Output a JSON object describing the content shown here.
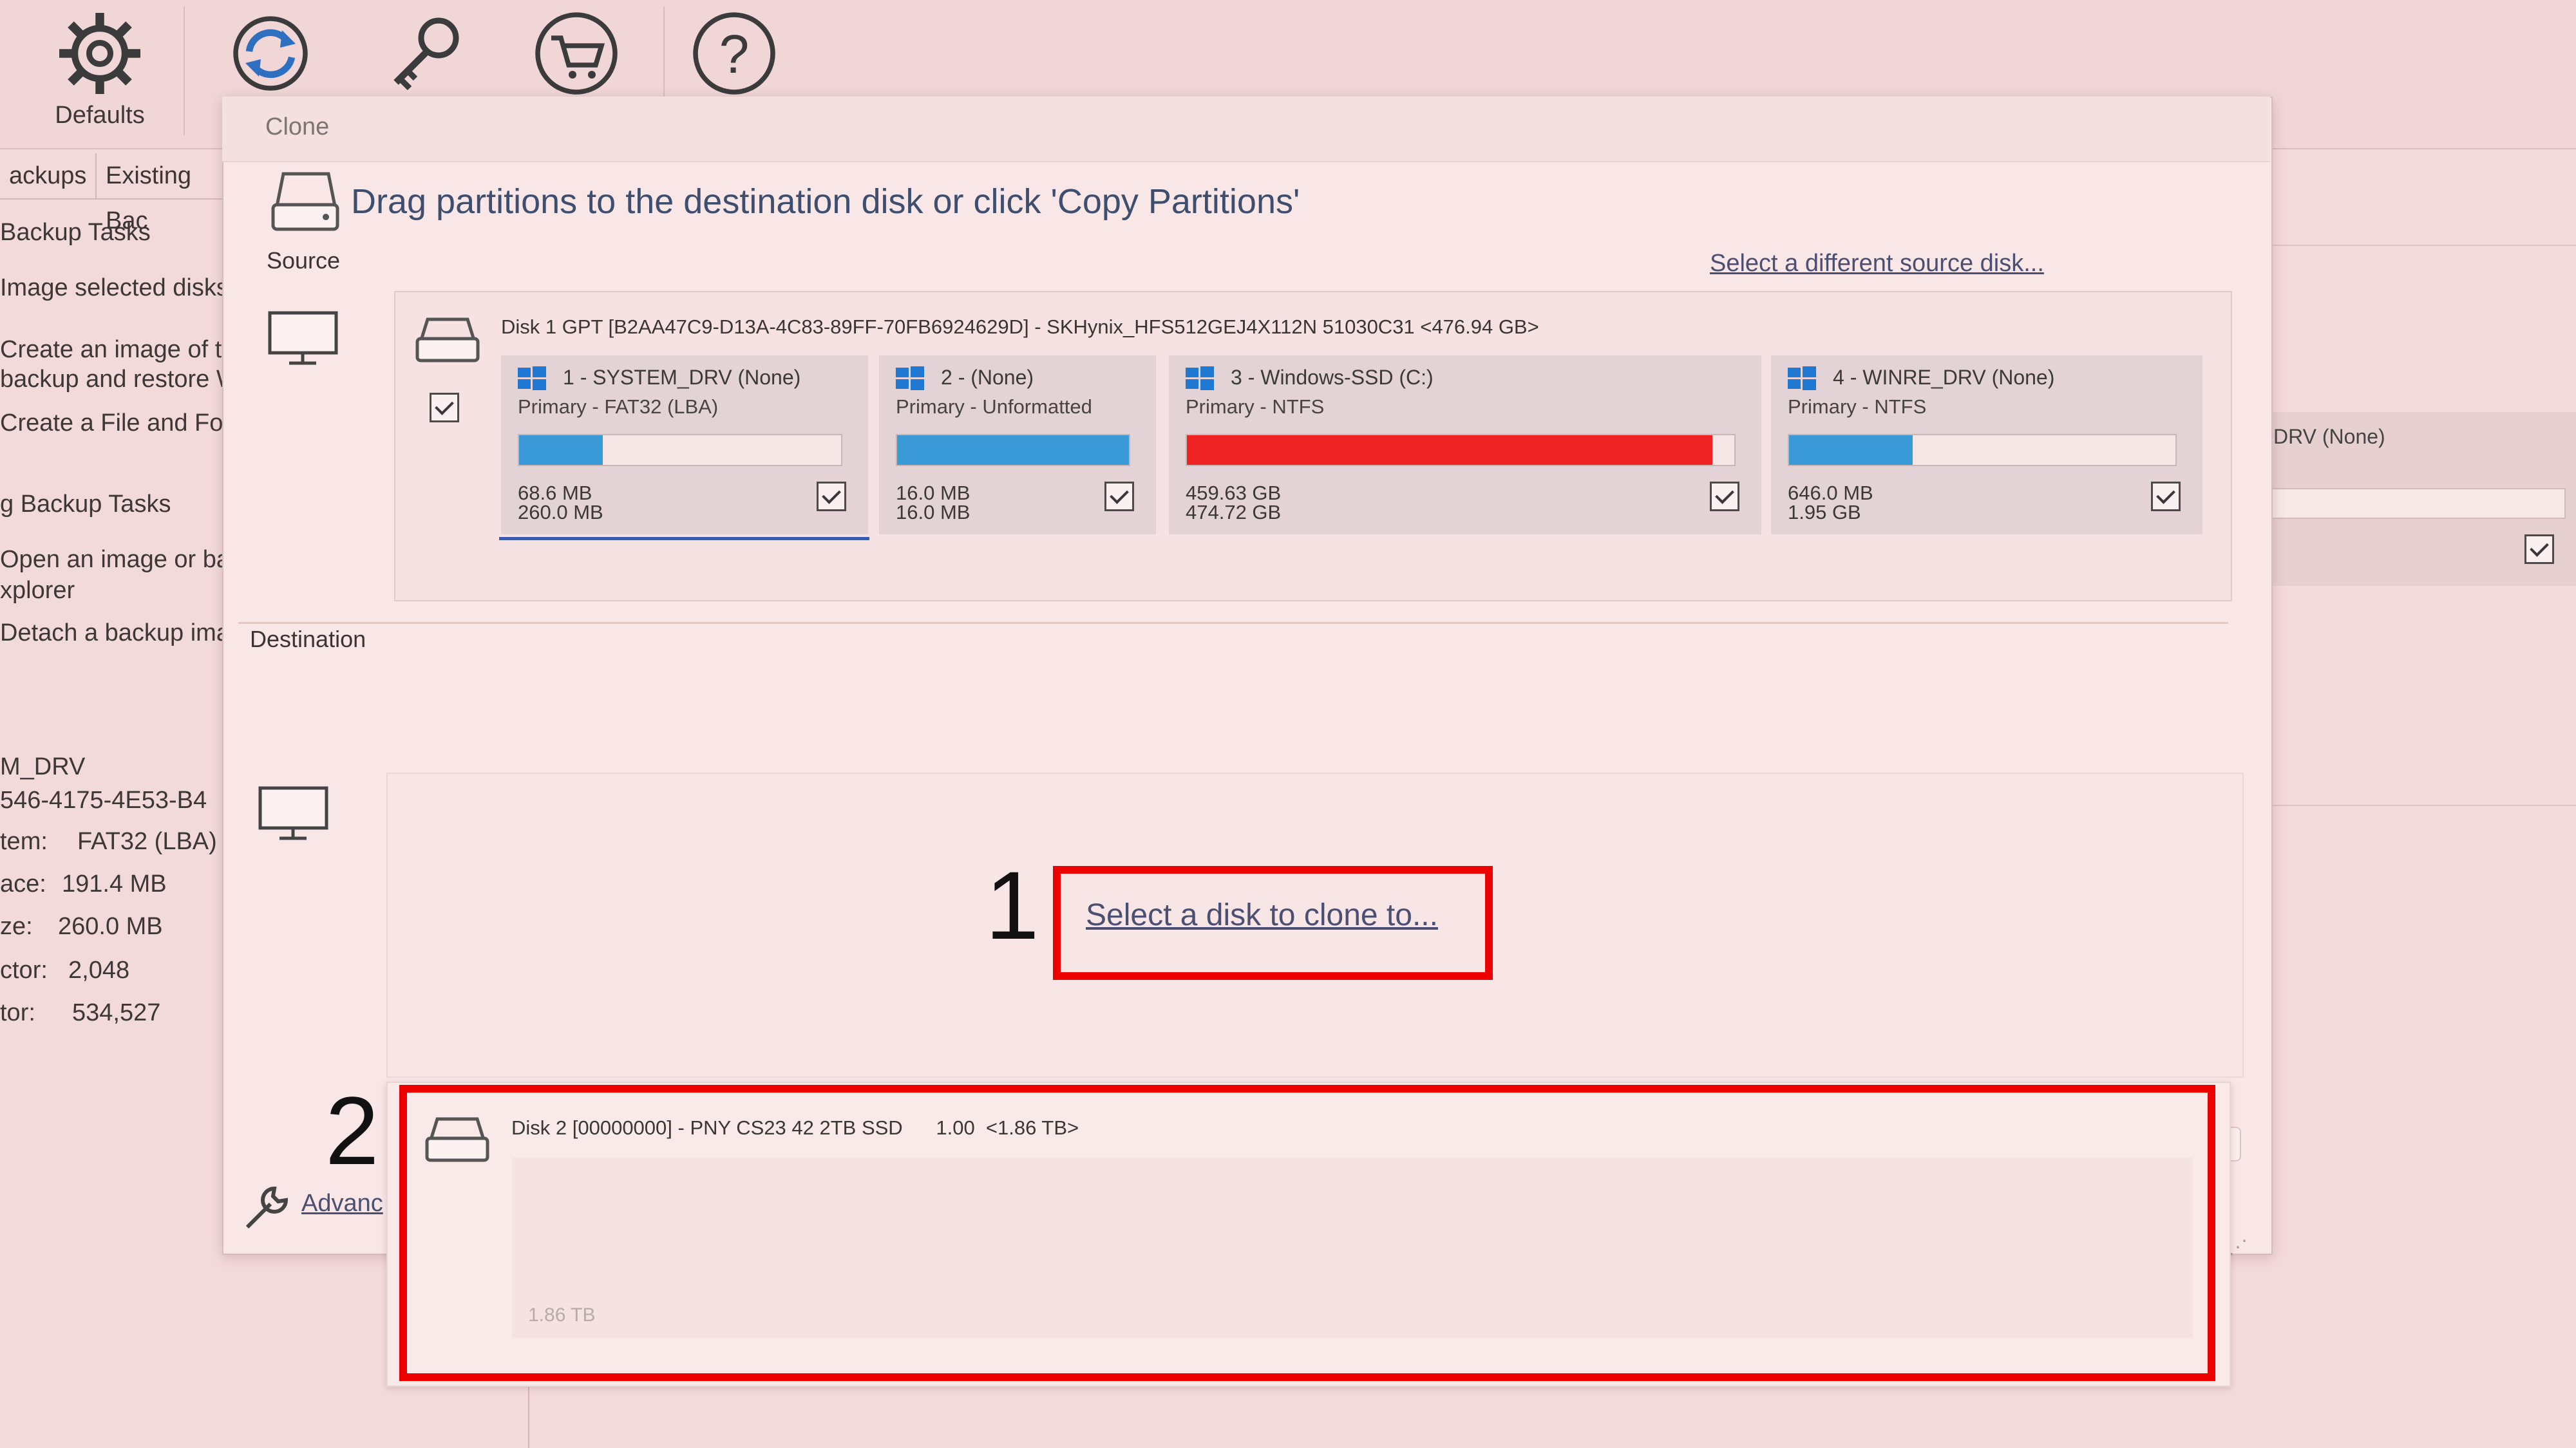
{
  "toolbar": {
    "defaults_label": "Defaults",
    "updates_label": "U"
  },
  "left_panel": {
    "tabs": [
      "ackups",
      "Existing Bac"
    ],
    "lines": [
      "Backup Tasks",
      "Image selected disks",
      "Create an image of th",
      "backup and restore W",
      "Create a File and Fold",
      "g Backup Tasks",
      "Open an image or ba",
      "xplorer",
      "Detach a backup ima"
    ],
    "details": {
      "name": "M_DRV",
      "guid": "546-4175-4E53-B4",
      "fs_label": "tem:",
      "fs_value": "FAT32 (LBA)",
      "free_label": "ace:",
      "free_value": "191.4 MB",
      "size_label": "ze:",
      "size_value": "260.0 MB",
      "first_label": "ctor:",
      "first_value": "2,048",
      "last_label": "tor:",
      "last_value": "534,527"
    }
  },
  "background_right": {
    "partition_label": "DRV (None)"
  },
  "dialog": {
    "title": "Clone",
    "heading": "Drag partitions to the destination disk or click 'Copy Partitions'",
    "source_label": "Source",
    "destination_label": "Destination",
    "select_source_link": "Select a different source disk...",
    "source_disk_header": "Disk 1 GPT [B2AA47C9-D13A-4C83-89FF-70FB6924629D] - SKHynix_HFS512GEJ4X112N 51030C31  <476.94 GB>",
    "partitions": [
      {
        "name": "1 - SYSTEM_DRV (None)",
        "type": "Primary - FAT32 (LBA)",
        "used": "68.6 MB",
        "size": "260.0 MB",
        "fill_fraction": 0.26,
        "color": "#3a9ad8",
        "checked": true
      },
      {
        "name": "2 -  (None)",
        "type": "Primary - Unformatted",
        "used": "16.0 MB",
        "size": "16.0 MB",
        "fill_fraction": 1.0,
        "color": "#3a9ad8",
        "checked": true
      },
      {
        "name": "3 - Windows-SSD (C:)",
        "type": "Primary - NTFS",
        "used": "459.63 GB",
        "size": "474.72 GB",
        "fill_fraction": 0.96,
        "color": "#ee2424",
        "checked": true
      },
      {
        "name": "4 - WINRE_DRV (None)",
        "type": "Primary - NTFS",
        "used": "646.0 MB",
        "size": "1.95 GB",
        "fill_fraction": 0.32,
        "color": "#3a9ad8",
        "checked": true
      }
    ],
    "select_dest_link": "Select a disk to clone to...",
    "advanced_label": "Advanc",
    "annotation_1": "1",
    "annotation_2": "2",
    "dest_disk": {
      "header": "Disk 2 [00000000] - PNY CS23 42 2TB SSD      1.00  <1.86 TB>",
      "capacity": "1.86 TB"
    },
    "accent_color": "#ed0000"
  }
}
